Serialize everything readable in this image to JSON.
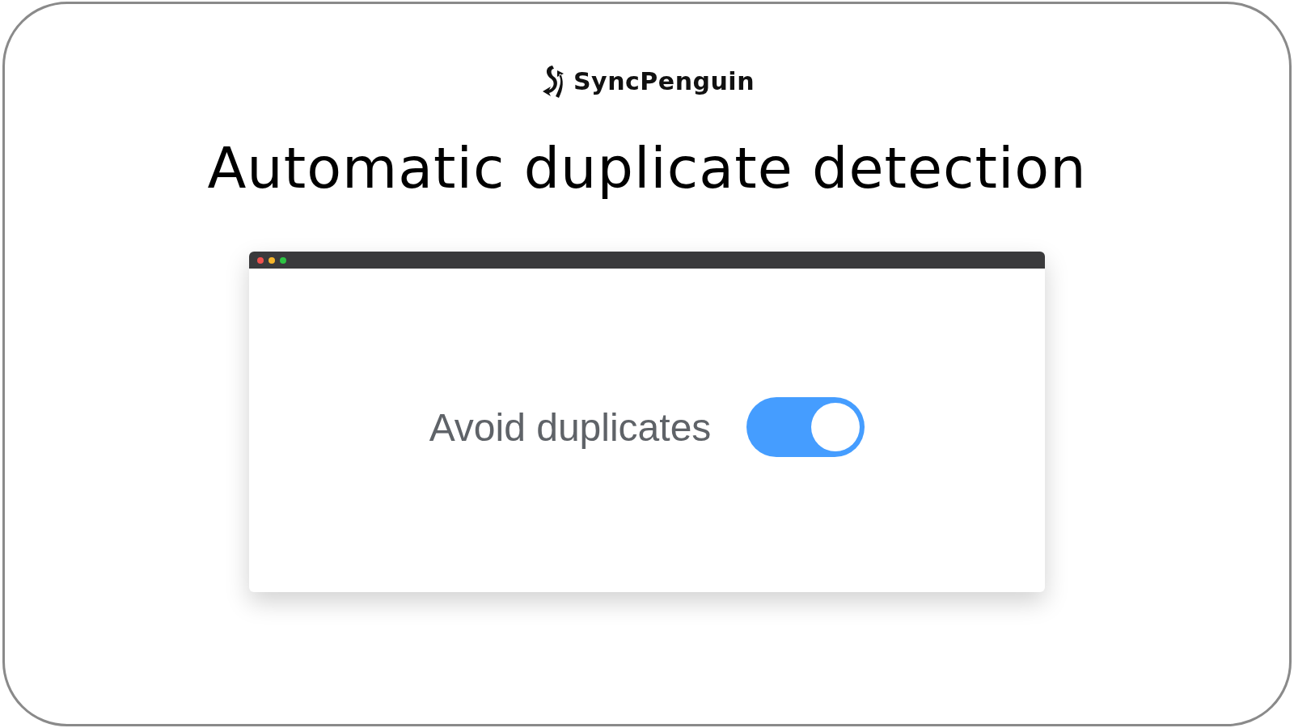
{
  "brand": {
    "name": "SyncPenguin"
  },
  "headline": "Automatic duplicate detection",
  "window": {
    "setting": {
      "label": "Avoid duplicates",
      "on": true
    }
  }
}
